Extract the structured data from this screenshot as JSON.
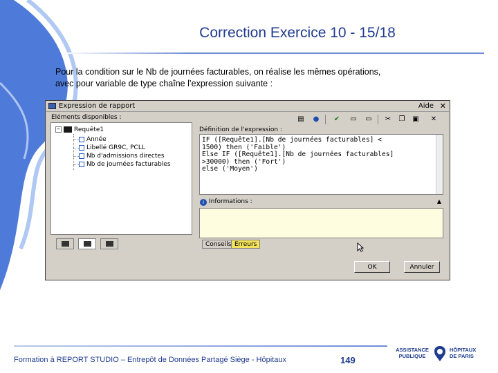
{
  "slide": {
    "title": "Correction Exercice 10 - 15/18",
    "intro_line1": "Pour la condition sur le Nb de journées facturables, on réalise les mêmes opérations,",
    "intro_line2": "avec pour variable de type chaîne l’expression suivante :"
  },
  "dialog": {
    "title": "Expression de rapport",
    "help": "Aide",
    "close": "✕",
    "left_panel_label": "Eléments disponibles :",
    "tree": {
      "root": "Requête1",
      "items": [
        "Année",
        "Libellé GR9C, PCLL",
        "Nb d'admissions directes",
        "Nb de journées facturables"
      ]
    },
    "toolbar_icons": [
      "properties-icon",
      "info-icon",
      "validate-icon",
      "field-icon",
      "field-alt-icon",
      "cut-icon",
      "copy-icon",
      "paste-icon",
      "delete-icon"
    ],
    "expression_label": "Définition de l'expression :",
    "expression_lines": [
      "IF ([Requête1].[Nb de journées facturables] <",
      "1500) then ('Faible')",
      "Else IF ([Requête1].[Nb de journées facturables]",
      ">30000) then ('Fort')",
      "else ('Moyen')"
    ],
    "info_label": "Informations :",
    "bottom_tabs": [
      "Conseils",
      "Erreurs"
    ],
    "ok_label": "OK",
    "cancel_label": "Annuler"
  },
  "footer": {
    "text": "Formation à REPORT STUDIO – Entrepôt de Données Partagé Siège - Hôpitaux",
    "page_number": "149",
    "logo_left_line1": "ASSISTANCE",
    "logo_left_line2": "PUBLIQUE",
    "logo_right_line1": "HÔPITAUX",
    "logo_right_line2": "DE PARIS"
  },
  "colors": {
    "title": "#1f3b8f",
    "swirl": "#3a6fd8",
    "dialog_bg": "#d4d0c8",
    "info_bg": "#fffde0",
    "active_tab": "#f2e35a"
  }
}
